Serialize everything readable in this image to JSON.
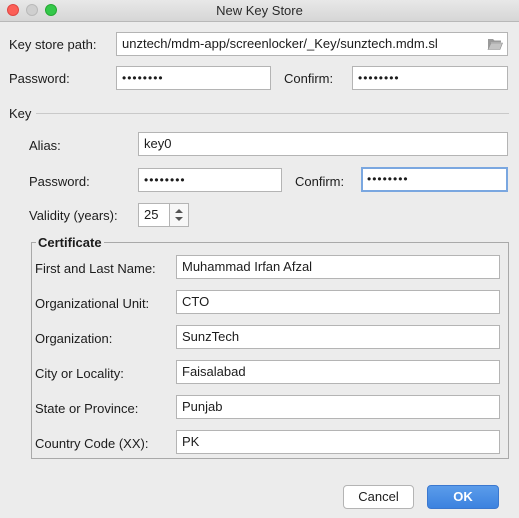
{
  "window": {
    "title": "New Key Store"
  },
  "keystore": {
    "path_label": "Key store path:",
    "path_value": "unztech/mdm-app/screenlocker/_Key/sunztech.mdm.sl",
    "password_label": "Password:",
    "password_value": "••••••••",
    "confirm_label": "Confirm:",
    "confirm_value": "••••••••"
  },
  "key": {
    "section_label": "Key",
    "alias_label": "Alias:",
    "alias_value": "key0",
    "password_label": "Password:",
    "password_value": "••••••••",
    "confirm_label": "Confirm:",
    "confirm_value": "••••••••",
    "validity_label": "Validity (years):",
    "validity_value": "25"
  },
  "certificate": {
    "legend": "Certificate",
    "fields": [
      {
        "label": "First and Last Name:",
        "value": "Muhammad Irfan Afzal"
      },
      {
        "label": "Organizational Unit:",
        "value": "CTO"
      },
      {
        "label": "Organization:",
        "value": "SunzTech"
      },
      {
        "label": "City or Locality:",
        "value": "Faisalabad"
      },
      {
        "label": "State or Province:",
        "value": "Punjab"
      },
      {
        "label": "Country Code (XX):",
        "value": "PK"
      }
    ]
  },
  "buttons": {
    "cancel": "Cancel",
    "ok": "OK"
  },
  "icons": {
    "folder": "folder-open-icon",
    "spinner": "stepper-arrows-icon"
  },
  "colors": {
    "accent": "#3c82df",
    "focus_ring": "#7aa7e0",
    "close": "#fc5f57",
    "maximize": "#34c84a"
  }
}
